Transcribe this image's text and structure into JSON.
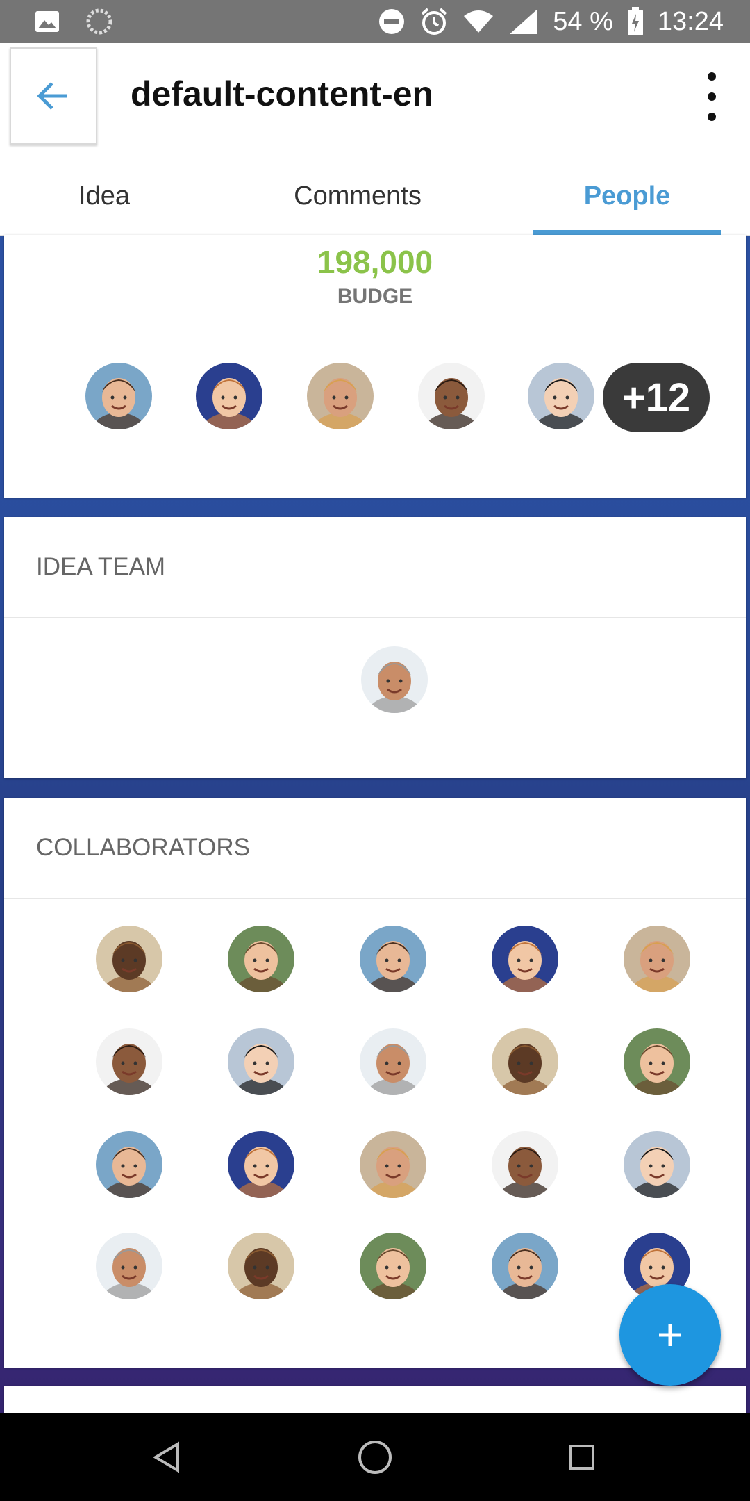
{
  "status_bar": {
    "battery": "54 %",
    "time": "13:24",
    "icons": [
      "image-icon",
      "sync-icon",
      "do-not-disturb-icon",
      "alarm-icon",
      "wifi-icon",
      "signal-icon",
      "battery-charging-icon"
    ]
  },
  "app_bar": {
    "title": "default-content-en",
    "back_icon": "arrow-back-icon",
    "menu_icon": "more-vert-icon"
  },
  "tabs": [
    {
      "label": "Idea",
      "active": false
    },
    {
      "label": "Comments",
      "active": false
    },
    {
      "label": "People",
      "active": true
    }
  ],
  "budget": {
    "value": "198,000",
    "label": "BUDGE",
    "avatars_shown": 5,
    "more_count": "+12"
  },
  "idea_team": {
    "heading": "IDEA TEAM",
    "members": 1
  },
  "collaborators": {
    "heading": "COLLABORATORS",
    "rows": 4,
    "per_row": 5
  },
  "fab": {
    "icon": "plus-icon"
  },
  "colors": {
    "accent": "#4a9bd4",
    "budget": "#8bc34a",
    "fab": "#1e96e0",
    "badge": "#3a3a3a"
  }
}
